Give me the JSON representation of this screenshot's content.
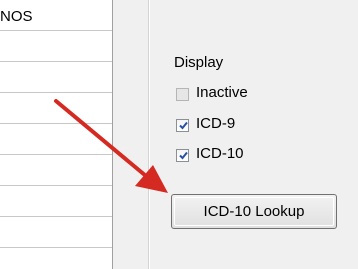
{
  "grid": {
    "first_row_text": "NOS",
    "row_count": 9
  },
  "display_group": {
    "heading": "Display",
    "options": [
      {
        "label": "Inactive",
        "checked": false,
        "enabled": false
      },
      {
        "label": "ICD-9",
        "checked": true,
        "enabled": true
      },
      {
        "label": "ICD-10",
        "checked": true,
        "enabled": true
      }
    ],
    "lookup_button_label": "ICD-10 Lookup"
  },
  "colors": {
    "annotation_arrow": "#d42a22",
    "checkmark": "#2a4fa8"
  }
}
